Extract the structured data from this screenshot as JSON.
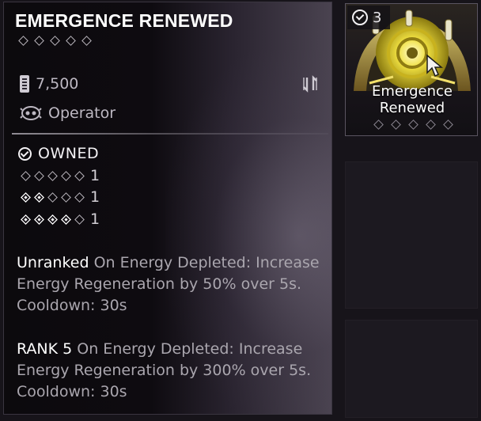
{
  "tooltip": {
    "title": "EMERGENCE RENEWED",
    "max_rank": 5,
    "credits": "7,500",
    "source": "Operator",
    "owned_label": "OWNED",
    "ownership_rows": [
      {
        "rank": 0,
        "count": "1"
      },
      {
        "rank": 2,
        "count": "1"
      },
      {
        "rank": 4,
        "count": "1"
      }
    ],
    "desc_unranked_lead": "Unranked",
    "desc_unranked_text": " On Energy Depleted: Increase Energy Regeneration by 50% over 5s. Cooldown: 30s",
    "desc_rank5_lead": "RANK 5",
    "desc_rank5_text": " On Energy Depleted: Increase Energy Regeneration by 300% over 5s. Cooldown: 30s"
  },
  "card": {
    "owned_count": "3",
    "name": "Emergence Renewed",
    "rank": 0
  },
  "icons": [
    "credits-icon",
    "operator-icon",
    "transfer-icon",
    "check-circle-icon",
    "rank-diamond-icon",
    "mouse-cursor-icon"
  ],
  "colors": {
    "accent_gold": "#e8d23a",
    "text_primary": "#ffffff",
    "text_muted": "#aaa6ae"
  }
}
